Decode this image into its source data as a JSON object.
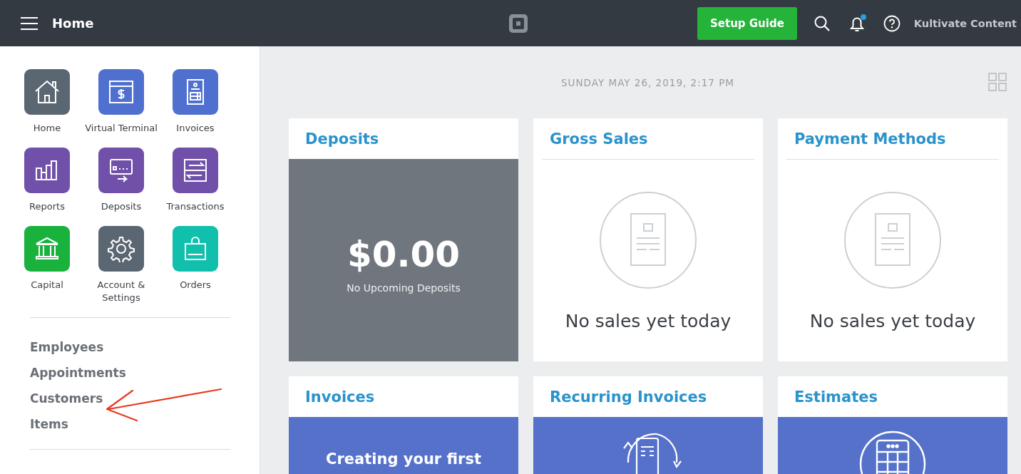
{
  "header": {
    "title": "Home",
    "setup_button": "Setup Guide",
    "notifications_unread": true,
    "account": "Kultivate Content"
  },
  "apps": [
    {
      "label": "Home",
      "color": "#5b6673"
    },
    {
      "label": "Virtual Terminal",
      "color": "#5070d0"
    },
    {
      "label": "Invoices",
      "color": "#5070d0"
    },
    {
      "label": "Reports",
      "color": "#7050a8"
    },
    {
      "label": "Deposits",
      "color": "#7050a8"
    },
    {
      "label": "Transactions",
      "color": "#7050a8"
    },
    {
      "label": "Capital",
      "color": "#18b23c"
    },
    {
      "label": "Account & Settings",
      "color": "#5b6673"
    },
    {
      "label": "Orders",
      "color": "#10c0ac"
    }
  ],
  "nav": [
    "Employees",
    "Appointments",
    "Customers",
    "Items"
  ],
  "date": "SUNDAY MAY 26, 2019, 2:17 PM",
  "cards": [
    {
      "title": "Deposits",
      "kind": "amount",
      "amount": "$0.00",
      "caption": "No Upcoming Deposits"
    },
    {
      "title": "Gross Sales",
      "kind": "empty",
      "caption": "No sales yet today"
    },
    {
      "title": "Payment Methods",
      "kind": "empty",
      "caption": "No sales yet today"
    },
    {
      "title": "Invoices",
      "kind": "promo",
      "caption": "Creating your first"
    },
    {
      "title": "Recurring Invoices",
      "kind": "recurring"
    },
    {
      "title": "Estimates",
      "kind": "estimates"
    }
  ]
}
